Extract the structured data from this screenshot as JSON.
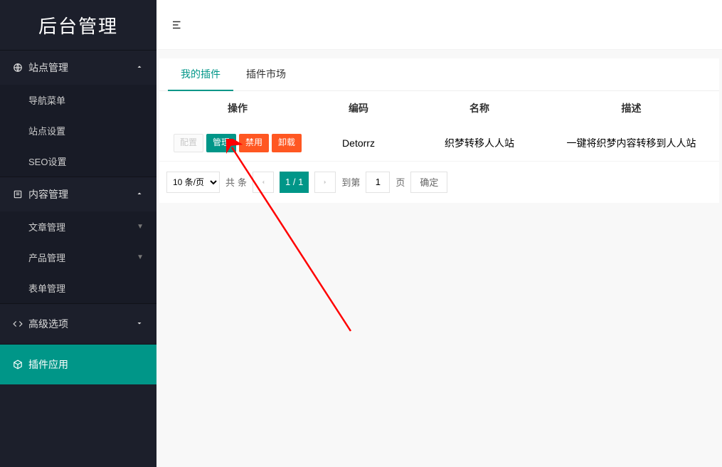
{
  "app": {
    "title": "后台管理"
  },
  "sidebar": {
    "groups": [
      {
        "id": "site",
        "label": "站点管理",
        "icon": "globe",
        "expanded": true,
        "items": [
          {
            "id": "nav-menu",
            "label": "导航菜单"
          },
          {
            "id": "site-settings",
            "label": "站点设置"
          },
          {
            "id": "seo-settings",
            "label": "SEO设置"
          }
        ]
      },
      {
        "id": "content",
        "label": "内容管理",
        "icon": "file",
        "expanded": true,
        "items": [
          {
            "id": "articles",
            "label": "文章管理",
            "hasSub": true
          },
          {
            "id": "products",
            "label": "产品管理",
            "hasSub": true
          },
          {
            "id": "forms",
            "label": "表单管理"
          }
        ]
      },
      {
        "id": "advanced",
        "label": "高级选项",
        "icon": "code",
        "collapsed": true
      },
      {
        "id": "plugins",
        "label": "插件应用",
        "icon": "box",
        "active": true
      }
    ]
  },
  "tabs": {
    "items": [
      {
        "id": "my-plugins",
        "label": "我的插件",
        "active": true
      },
      {
        "id": "plugin-market",
        "label": "插件市场"
      }
    ]
  },
  "table": {
    "headers": {
      "ops": "操作",
      "code": "编码",
      "name": "名称",
      "desc": "描述"
    },
    "rows": [
      {
        "actions": {
          "config": "配置",
          "manage": "管理",
          "disable": "禁用",
          "uninstall": "卸载"
        },
        "code": "Detorrz",
        "name": "织梦转移人人站",
        "desc": "一键将织梦内容转移到人人站"
      }
    ]
  },
  "pager": {
    "pageSizeLabel": "10 条/页",
    "totalPrefix": "共",
    "totalSuffix": "条",
    "current": "1 / 1",
    "gotoPrefix": "到第",
    "gotoSuffix": "页",
    "gotoValue": "1",
    "confirm": "确定"
  }
}
